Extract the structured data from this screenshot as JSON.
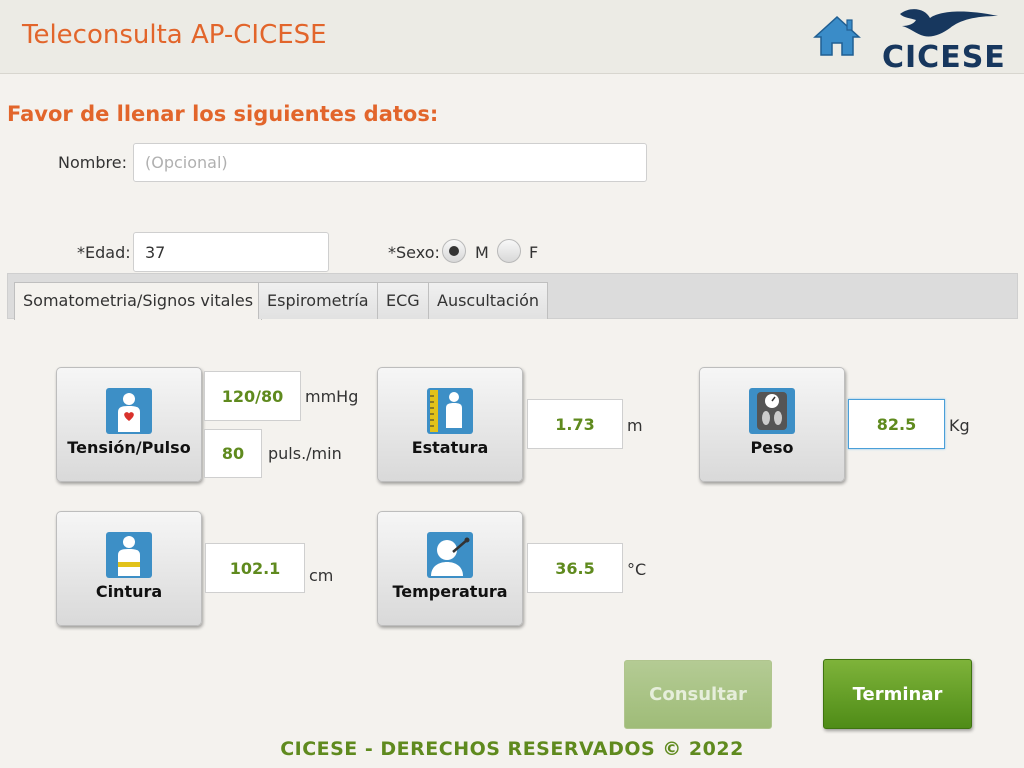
{
  "header": {
    "title": "Teleconsulta AP-CICESE",
    "logo_text": "CICESE"
  },
  "form": {
    "instructions": "Favor de llenar los siguientes datos:",
    "nombre_label": "Nombre:",
    "nombre_placeholder": "(Opcional)",
    "nombre_value": "",
    "edad_label": "*Edad:",
    "edad_value": "37",
    "sexo_label": "*Sexo:",
    "sexo_options": [
      "M",
      "F"
    ],
    "sexo_selected": "M"
  },
  "tabs": [
    {
      "label": "Somatometria/Signos vitales",
      "active": true
    },
    {
      "label": "Espirometría",
      "active": false
    },
    {
      "label": "ECG",
      "active": false
    },
    {
      "label": "Auscultación",
      "active": false
    }
  ],
  "measurements": {
    "tension": {
      "label": "Tensión/Pulso",
      "icon": "heart-person-icon",
      "bp_value": "120/80",
      "bp_unit": "mmHg",
      "pulse_value": "80",
      "pulse_unit": "puls./min"
    },
    "estatura": {
      "label": "Estatura",
      "icon": "height-ruler-icon",
      "value": "1.73",
      "unit": "m"
    },
    "peso": {
      "label": "Peso",
      "icon": "scale-icon",
      "value": "82.5",
      "unit": "Kg"
    },
    "cintura": {
      "label": "Cintura",
      "icon": "waist-tape-icon",
      "value": "102.1",
      "unit": "cm"
    },
    "temperatura": {
      "label": "Temperatura",
      "icon": "thermometer-person-icon",
      "value": "36.5",
      "unit": "°C"
    }
  },
  "actions": {
    "consultar": "Consultar",
    "terminar": "Terminar"
  },
  "footer": "CICESE - DERECHOS RESERVADOS © 2022",
  "colors": {
    "accent_orange": "#e2652b",
    "accent_green": "#5f8a1e",
    "icon_blue": "#3d8fc6",
    "brand_navy": "#17375e"
  }
}
